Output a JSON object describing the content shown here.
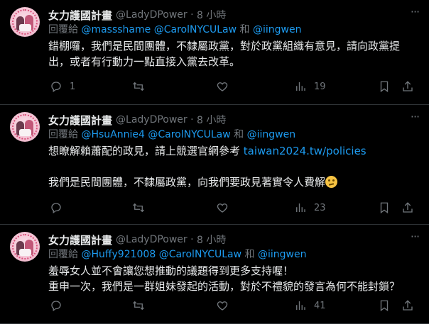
{
  "tweets": [
    {
      "name": "女力護國計畫",
      "handle": "@LadyDPower",
      "sep": "·",
      "time": "8 小時",
      "reply_prefix": "回覆給",
      "mention1": "@massshame",
      "mention2": "@CarolNYCULaw",
      "and": "和",
      "mention3": "@iingwen",
      "text_lines": [
        "錯棚囉，我們是民間團體，不隸屬政黨，對於政黨組織有意見，請向政黨提",
        "出，或者有行動力一點直接入黨去改革。"
      ],
      "reply_count": "1",
      "retweet_count": "",
      "like_count": "",
      "views_count": "19"
    },
    {
      "name": "女力護國計畫",
      "handle": "@LadyDPower",
      "sep": "·",
      "time": "8 小時",
      "reply_prefix": "回覆給",
      "mention1": "@HsuAnnie4",
      "mention2": "@CarolNYCULaw",
      "and": "和",
      "mention3": "@iingwen",
      "text_line1": "想瞭解賴蕭配的政見，請上競選官網參考 ",
      "link": "taiwan2024.tw/policies",
      "text_line2": "我們是民間團體，不隸屬政黨，向我們要政見著實令人費解",
      "emoji": "thinking-face",
      "reply_count": "",
      "retweet_count": "",
      "like_count": "",
      "views_count": "23"
    },
    {
      "name": "女力護國計畫",
      "handle": "@LadyDPower",
      "sep": "·",
      "time": "8 小時",
      "reply_prefix": "回覆給",
      "mention1": "@Huffy921008",
      "mention2": "@CarolNYCULaw",
      "and": "和",
      "mention3": "@iingwen",
      "text_lines": [
        "羞辱女人並不會讓您想推動的議題得到更多支持喔！",
        "重申一次，我們是一群姐妹發起的活動，對於不禮貌的發言為何不能封鎖？"
      ],
      "reply_count": "",
      "retweet_count": "",
      "like_count": "",
      "views_count": "41"
    }
  ],
  "icons": {
    "more": "more-dots-icon",
    "reply": "reply-icon",
    "retweet": "retweet-icon",
    "like": "heart-icon",
    "views": "views-chart-icon",
    "bookmark": "bookmark-icon",
    "share": "share-icon"
  },
  "colors": {
    "background": "#000000",
    "text": "#e7e9ea",
    "muted": "#71767b",
    "accent": "#1d9bf0",
    "divider": "#2f3336"
  }
}
